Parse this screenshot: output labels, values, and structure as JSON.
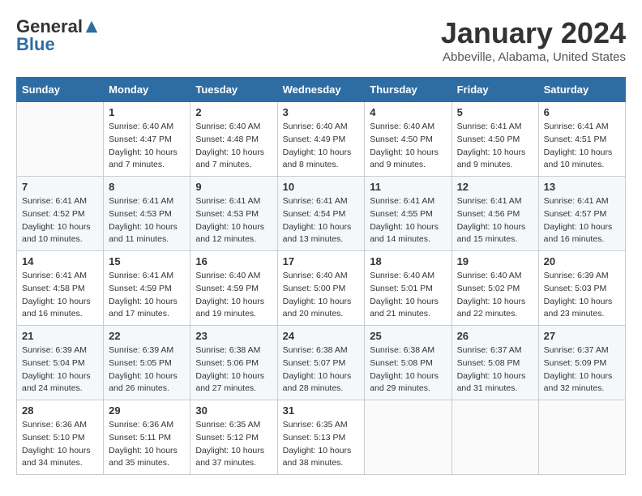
{
  "header": {
    "logo_general": "General",
    "logo_blue": "Blue",
    "month_title": "January 2024",
    "location": "Abbeville, Alabama, United States"
  },
  "columns": [
    "Sunday",
    "Monday",
    "Tuesday",
    "Wednesday",
    "Thursday",
    "Friday",
    "Saturday"
  ],
  "weeks": [
    [
      {
        "day": "",
        "info": ""
      },
      {
        "day": "1",
        "info": "Sunrise: 6:40 AM\nSunset: 4:47 PM\nDaylight: 10 hours\nand 7 minutes."
      },
      {
        "day": "2",
        "info": "Sunrise: 6:40 AM\nSunset: 4:48 PM\nDaylight: 10 hours\nand 7 minutes."
      },
      {
        "day": "3",
        "info": "Sunrise: 6:40 AM\nSunset: 4:49 PM\nDaylight: 10 hours\nand 8 minutes."
      },
      {
        "day": "4",
        "info": "Sunrise: 6:40 AM\nSunset: 4:50 PM\nDaylight: 10 hours\nand 9 minutes."
      },
      {
        "day": "5",
        "info": "Sunrise: 6:41 AM\nSunset: 4:50 PM\nDaylight: 10 hours\nand 9 minutes."
      },
      {
        "day": "6",
        "info": "Sunrise: 6:41 AM\nSunset: 4:51 PM\nDaylight: 10 hours\nand 10 minutes."
      }
    ],
    [
      {
        "day": "7",
        "info": "Sunrise: 6:41 AM\nSunset: 4:52 PM\nDaylight: 10 hours\nand 10 minutes."
      },
      {
        "day": "8",
        "info": "Sunrise: 6:41 AM\nSunset: 4:53 PM\nDaylight: 10 hours\nand 11 minutes."
      },
      {
        "day": "9",
        "info": "Sunrise: 6:41 AM\nSunset: 4:53 PM\nDaylight: 10 hours\nand 12 minutes."
      },
      {
        "day": "10",
        "info": "Sunrise: 6:41 AM\nSunset: 4:54 PM\nDaylight: 10 hours\nand 13 minutes."
      },
      {
        "day": "11",
        "info": "Sunrise: 6:41 AM\nSunset: 4:55 PM\nDaylight: 10 hours\nand 14 minutes."
      },
      {
        "day": "12",
        "info": "Sunrise: 6:41 AM\nSunset: 4:56 PM\nDaylight: 10 hours\nand 15 minutes."
      },
      {
        "day": "13",
        "info": "Sunrise: 6:41 AM\nSunset: 4:57 PM\nDaylight: 10 hours\nand 16 minutes."
      }
    ],
    [
      {
        "day": "14",
        "info": "Sunrise: 6:41 AM\nSunset: 4:58 PM\nDaylight: 10 hours\nand 16 minutes."
      },
      {
        "day": "15",
        "info": "Sunrise: 6:41 AM\nSunset: 4:59 PM\nDaylight: 10 hours\nand 17 minutes."
      },
      {
        "day": "16",
        "info": "Sunrise: 6:40 AM\nSunset: 4:59 PM\nDaylight: 10 hours\nand 19 minutes."
      },
      {
        "day": "17",
        "info": "Sunrise: 6:40 AM\nSunset: 5:00 PM\nDaylight: 10 hours\nand 20 minutes."
      },
      {
        "day": "18",
        "info": "Sunrise: 6:40 AM\nSunset: 5:01 PM\nDaylight: 10 hours\nand 21 minutes."
      },
      {
        "day": "19",
        "info": "Sunrise: 6:40 AM\nSunset: 5:02 PM\nDaylight: 10 hours\nand 22 minutes."
      },
      {
        "day": "20",
        "info": "Sunrise: 6:39 AM\nSunset: 5:03 PM\nDaylight: 10 hours\nand 23 minutes."
      }
    ],
    [
      {
        "day": "21",
        "info": "Sunrise: 6:39 AM\nSunset: 5:04 PM\nDaylight: 10 hours\nand 24 minutes."
      },
      {
        "day": "22",
        "info": "Sunrise: 6:39 AM\nSunset: 5:05 PM\nDaylight: 10 hours\nand 26 minutes."
      },
      {
        "day": "23",
        "info": "Sunrise: 6:38 AM\nSunset: 5:06 PM\nDaylight: 10 hours\nand 27 minutes."
      },
      {
        "day": "24",
        "info": "Sunrise: 6:38 AM\nSunset: 5:07 PM\nDaylight: 10 hours\nand 28 minutes."
      },
      {
        "day": "25",
        "info": "Sunrise: 6:38 AM\nSunset: 5:08 PM\nDaylight: 10 hours\nand 29 minutes."
      },
      {
        "day": "26",
        "info": "Sunrise: 6:37 AM\nSunset: 5:08 PM\nDaylight: 10 hours\nand 31 minutes."
      },
      {
        "day": "27",
        "info": "Sunrise: 6:37 AM\nSunset: 5:09 PM\nDaylight: 10 hours\nand 32 minutes."
      }
    ],
    [
      {
        "day": "28",
        "info": "Sunrise: 6:36 AM\nSunset: 5:10 PM\nDaylight: 10 hours\nand 34 minutes."
      },
      {
        "day": "29",
        "info": "Sunrise: 6:36 AM\nSunset: 5:11 PM\nDaylight: 10 hours\nand 35 minutes."
      },
      {
        "day": "30",
        "info": "Sunrise: 6:35 AM\nSunset: 5:12 PM\nDaylight: 10 hours\nand 37 minutes."
      },
      {
        "day": "31",
        "info": "Sunrise: 6:35 AM\nSunset: 5:13 PM\nDaylight: 10 hours\nand 38 minutes."
      },
      {
        "day": "",
        "info": ""
      },
      {
        "day": "",
        "info": ""
      },
      {
        "day": "",
        "info": ""
      }
    ]
  ]
}
